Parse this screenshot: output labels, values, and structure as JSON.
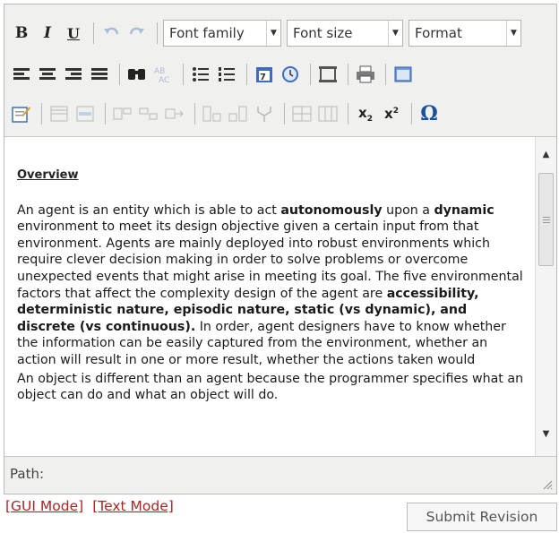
{
  "toolbar": {
    "bold": "B",
    "italic": "I",
    "underline": "U",
    "font_family": "Font family",
    "font_size": "Font size",
    "format": "Format",
    "subscript": "x",
    "subscript_mark": "2",
    "superscript": "x",
    "superscript_mark": "2",
    "special_char": "Ω",
    "icons": [
      "bold-icon",
      "italic-icon",
      "underline-icon",
      "undo-icon",
      "redo-icon",
      "align-left-icon",
      "align-center-icon",
      "align-right-icon",
      "justify-icon",
      "find-icon",
      "replace-icon",
      "bullet-list-icon",
      "numbered-list-icon",
      "insert-date-icon",
      "insert-time-icon",
      "horizontal-rule-icon",
      "print-icon",
      "fullscreen-icon",
      "edit-html-icon",
      "table-icon",
      "row-props-icon",
      "cell-props-icon",
      "insert-row-icon",
      "delete-row-icon",
      "insert-col-icon",
      "delete-col-icon",
      "merge-cells-icon",
      "split-cells-icon",
      "subscript-icon",
      "superscript-icon",
      "omega-icon"
    ]
  },
  "content": {
    "heading": "Overview",
    "para1_a": "An agent is an entity which is able to act ",
    "para1_bold1": "autonomously",
    "para1_b": " upon a ",
    "para1_bold2": "dynamic",
    "para1_c": " environment to meet its design objective given a certain input from that environment. Agents are mainly deployed into robust environments which require clever decision making in order to solve problems or overcome unexpected events that might arise in meeting its goal. The five environmental factors that affect the complexity design of the agent are ",
    "para1_bold3": "accessibility, deterministic nature, episodic nature, static (vs dynamic), and discrete (vs continuous).",
    "para1_d": " In order, agent designers have to know whether the information can be easily captured from the environment, whether an action will result in one or more result, whether the actions taken would",
    "para2": "An object is different than an agent because the programmer specifies what an object can do and what an object will do."
  },
  "status": {
    "path_label": "Path:"
  },
  "modes": {
    "gui": "[GUI Mode]",
    "text": "[Text Mode]"
  },
  "actions": {
    "submit": "Submit Revision"
  }
}
